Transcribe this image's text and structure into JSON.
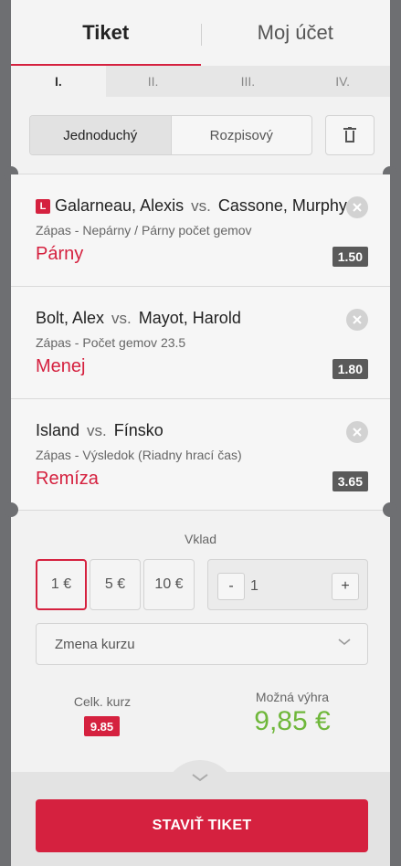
{
  "tabs": {
    "ticket": "Tiket",
    "account": "Moj účet"
  },
  "sub_tabs": [
    "I.",
    "II.",
    "III.",
    "IV."
  ],
  "bet_type": {
    "single": "Jednoduchý",
    "system": "Rozpisový"
  },
  "bets": [
    {
      "live_badge": "L",
      "home": "Galarneau, Alexis",
      "vs": "vs.",
      "away": "Cassone, Murphy",
      "market": "Zápas - Nepárny / Párny počet gemov",
      "selection": "Párny",
      "odds": "1.50"
    },
    {
      "home": "Bolt, Alex",
      "vs": "vs.",
      "away": "Mayot, Harold",
      "market": "Zápas - Počet gemov 23.5",
      "selection": "Menej",
      "odds": "1.80"
    },
    {
      "home": "Island",
      "vs": "vs.",
      "away": "Fínsko",
      "market": "Zápas - Výsledok (Riadny hrací čas)",
      "selection": "Remíza",
      "odds": "3.65"
    }
  ],
  "stake": {
    "label": "Vklad",
    "presets": [
      "1 €",
      "5 €",
      "10 €"
    ],
    "minus": "-",
    "plus": "+",
    "value": "1"
  },
  "odds_change": {
    "label": "Zmena kurzu"
  },
  "summary": {
    "total_odds_label": "Celk. kurz",
    "total_odds": "9.85",
    "win_label": "Možná výhra",
    "win_value": "9,85 €"
  },
  "submit_label": "STAVIŤ TIKET",
  "colors": {
    "accent": "#d5213f",
    "win": "#6fb73b",
    "odds_badge": "#5a5a5a",
    "frame": "#6e6f72"
  }
}
